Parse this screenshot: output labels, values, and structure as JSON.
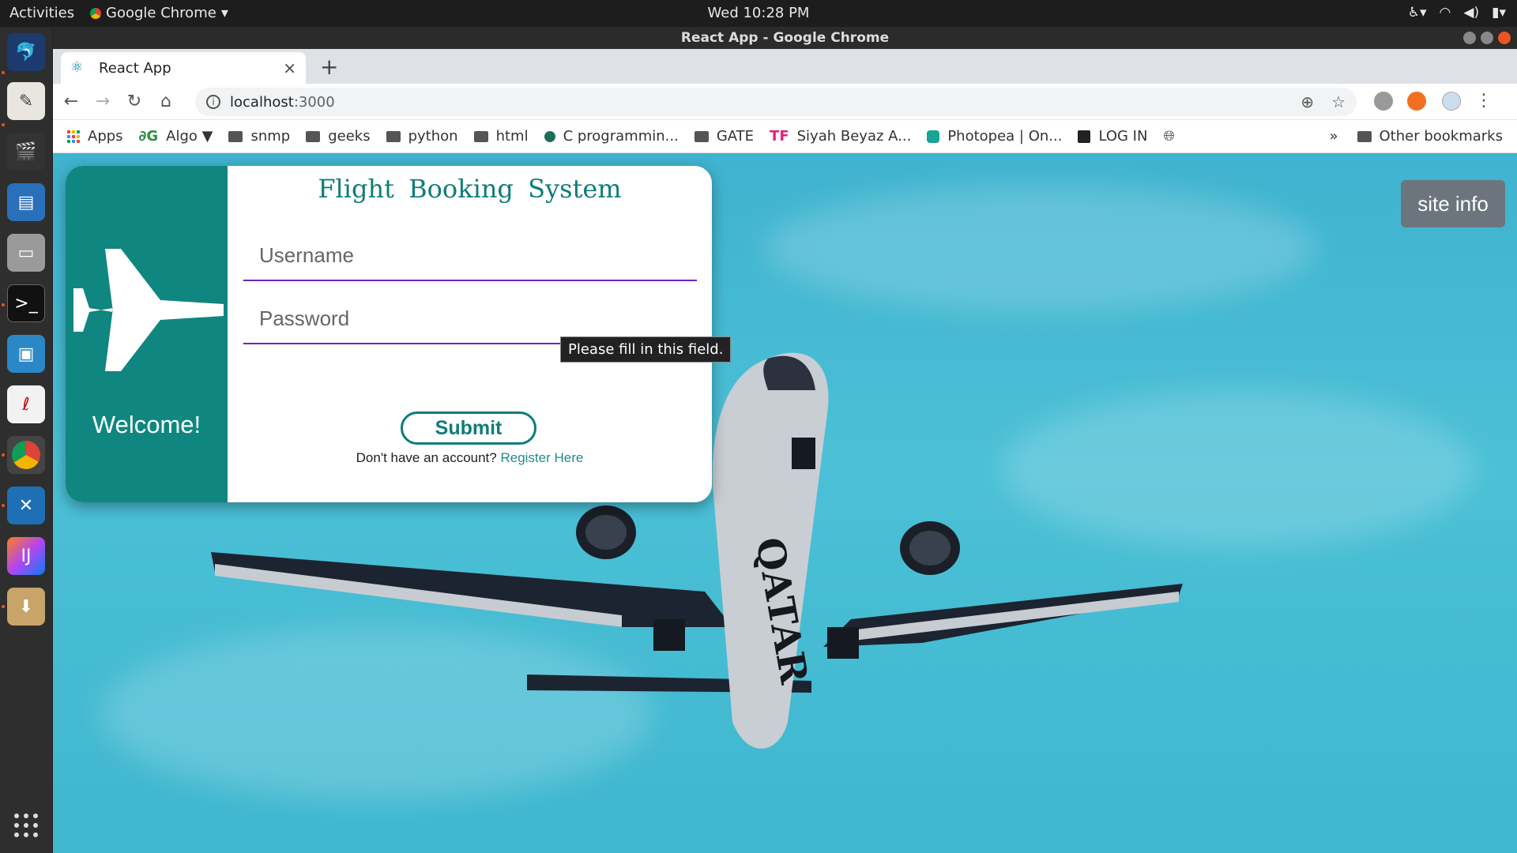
{
  "topbar": {
    "activities": "Activities",
    "app_menu": "Google Chrome",
    "clock": "Wed 10:28 PM"
  },
  "window": {
    "title": "React App - Google Chrome"
  },
  "tabs": [
    {
      "label": "React App",
      "close": "×"
    }
  ],
  "new_tab": "+",
  "omnibox": {
    "host": "localhost",
    "port": ":3000"
  },
  "bookmarks": [
    {
      "label": "Apps",
      "icon": "apps-grid-icon"
    },
    {
      "label": "Algo ▼",
      "icon": "algo-icon",
      "glyph": "∂G"
    },
    {
      "label": "snmp",
      "icon": "folder-icon"
    },
    {
      "label": "geeks",
      "icon": "folder-icon"
    },
    {
      "label": "python",
      "icon": "folder-icon"
    },
    {
      "label": "html",
      "icon": "folder-icon"
    },
    {
      "label": "C programmin...",
      "icon": "site-icon"
    },
    {
      "label": "GATE",
      "icon": "folder-icon"
    },
    {
      "label": "Siyah Beyaz A...",
      "icon": "tf-icon",
      "glyph": "TF"
    },
    {
      "label": "Photopea | On...",
      "icon": "photopea-icon"
    },
    {
      "label": "LOG IN",
      "icon": "building-icon"
    }
  ],
  "bookmarks_overflow": "»",
  "other_bookmarks": "Other bookmarks",
  "page": {
    "app_title": "Flight Booking System",
    "welcome": "Welcome!",
    "username_placeholder": "Username",
    "password_placeholder": "Password",
    "submit": "Submit",
    "no_account": "Don't have an account?",
    "register": "Register Here",
    "tooltip": "Please fill in this field.",
    "site_info": "site info",
    "plane_livery": "QATAR"
  },
  "colors": {
    "teal": "#0f8780",
    "sky": "#44bbd3",
    "underline": "#6a24c9",
    "site_info_bg": "#6c757d"
  }
}
